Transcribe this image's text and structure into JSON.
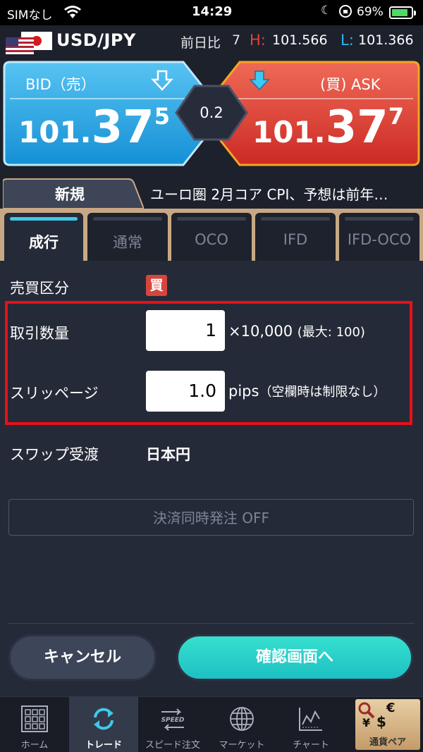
{
  "status_bar": {
    "carrier": "SIMなし",
    "time": "14:29",
    "battery": "69%"
  },
  "pair": {
    "name": "USD/JPY",
    "prev_label": "前日比",
    "prev_value": "7",
    "high_label": "H:",
    "high_value": "101.566",
    "low_label": "L:",
    "low_value": "101.366"
  },
  "bid": {
    "label": "BID（売）",
    "price_small": "101.",
    "price_big": "37",
    "price_sup": "5"
  },
  "ask": {
    "label": "(買) ASK",
    "price_small": "101.",
    "price_big": "37",
    "price_sup": "7"
  },
  "spread": "0.2",
  "tab_new": "新規",
  "news": "ユーロ圏 2月コア CPI、予想は前年…",
  "order_tabs": [
    "成行",
    "通常",
    "OCO",
    "IFD",
    "IFD-OCO"
  ],
  "form": {
    "side_label": "売買区分",
    "side_value": "買",
    "qty_label": "取引数量",
    "qty_value": "1",
    "qty_unit": "×10,000",
    "qty_note": "(最大: 100)",
    "slip_label": "スリッページ",
    "slip_value": "1.0",
    "slip_unit": "pips",
    "slip_note": "（空欄時は制限なし）",
    "swap_label": "スワップ受渡",
    "swap_value": "日本円",
    "settle_button": "決済同時発注 OFF"
  },
  "buttons": {
    "cancel": "キャンセル",
    "confirm": "確認画面へ"
  },
  "nav": {
    "home": "ホーム",
    "trade": "トレード",
    "speed": "スピード注文",
    "speed_icon_text": "SPEED",
    "market": "マーケット",
    "chart": "チャート",
    "pairs": "通貨ペア"
  },
  "colors": {
    "bid_blue": "#1fa8e8",
    "ask_red": "#e0443a",
    "accent_cyan": "#3ec9e8",
    "highlight_red": "#e8101a"
  }
}
